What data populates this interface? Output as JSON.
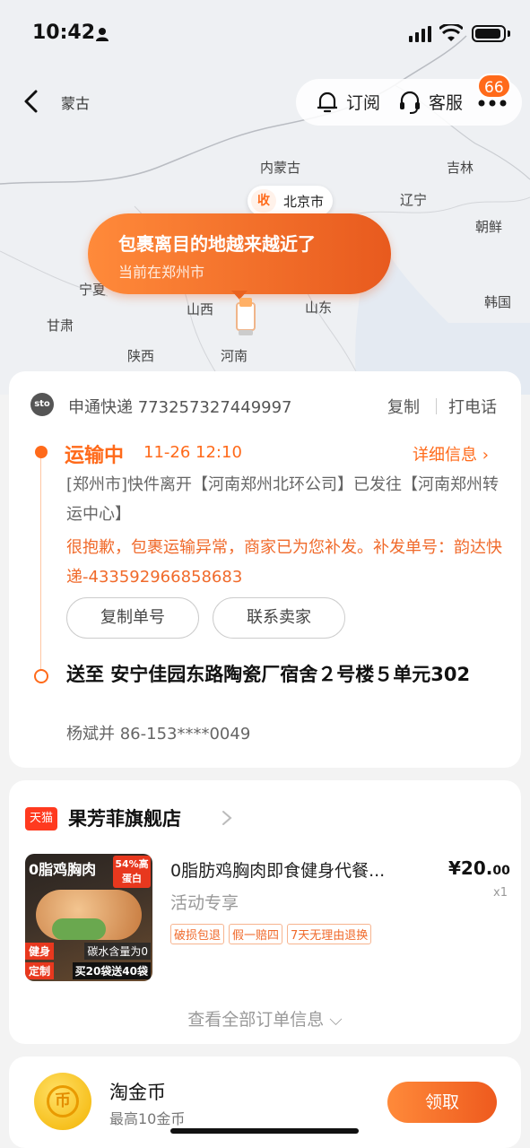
{
  "status_bar": {
    "time": "10:42"
  },
  "nav": {
    "title": "蒙古",
    "subscribe_label": "订阅",
    "service_label": "客服",
    "badge_count": "66"
  },
  "map": {
    "labels": [
      "内蒙古",
      "吉林",
      "辽宁",
      "朝鲜",
      "韩国",
      "宁夏",
      "甘肃",
      "山西",
      "山东",
      "陕西",
      "河南"
    ],
    "destination": {
      "badge": "收",
      "city": "北京市"
    },
    "bubble": {
      "title": "包裹离目的地越来越近了",
      "subtitle": "当前在郑州市"
    }
  },
  "tracking": {
    "carrier_logo": "sto",
    "carrier": "申通快递 773257327449997",
    "copy_label": "复制",
    "call_label": "打电话",
    "status": "运输中",
    "status_time": "11-26 12:10",
    "detail_label": "详细信息 ›",
    "description": "[郑州市]快件离开【河南郑州北环公司】已发往【河南郑州转运中心】",
    "warning": "很抱歉，包裹运输异常，商家已为您补发。补发单号：韵达快递-433592966858683",
    "btn_copy_number": "复制单号",
    "btn_contact_seller": "联系卖家",
    "address": "送至 安宁佳园东路陶瓷厂宿舍２号楼５单元302",
    "contact": "杨斌并 86-153****0049"
  },
  "order": {
    "store_badge": "天猫",
    "store_name": "果芳菲旗舰店",
    "product_image": {
      "title": "0脂鸡胸肉",
      "badge": "54%高蛋白",
      "bottom1": "健身",
      "bottom2": "定制",
      "note1": "碳水含量为0",
      "note2": "买20袋送40袋"
    },
    "product_name": "0脂肪鸡胸肉即食健身代餐...",
    "price_main": "¥20.",
    "price_decimal": "00",
    "quantity": "x1",
    "subtitle": "活动专享",
    "tags": [
      "破损包退",
      "假一赔四",
      "7天无理由退换"
    ],
    "view_all": "查看全部订单信息 ⌵"
  },
  "coins": {
    "icon_char": "币",
    "title": "淘金币",
    "subtitle": "最高10金币",
    "claim_label": "领取"
  }
}
